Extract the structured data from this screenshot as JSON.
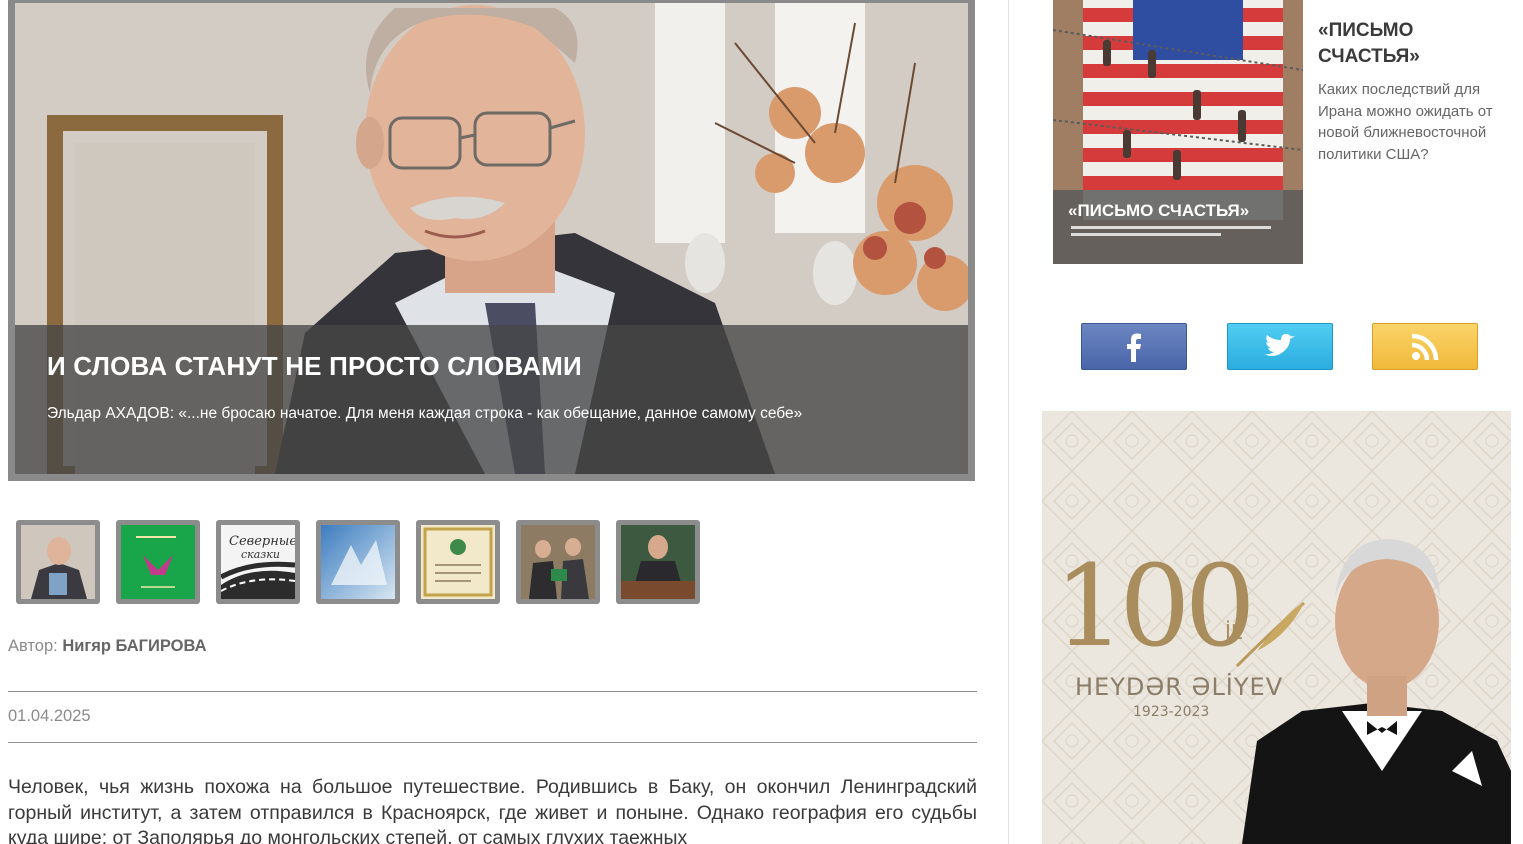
{
  "hero": {
    "title": "И СЛОВА СТАНУТ НЕ ПРОСТО СЛОВАМИ",
    "subtitle": "Эльдар АХАДОВ: «...не бросаю начатое. Для меня каждая строка - как обещание, данное самому себе»"
  },
  "gallery": {
    "thumbnails": [
      {
        "icon": "portrait-with-book-photo"
      },
      {
        "icon": "green-book-cover"
      },
      {
        "icon": "severnye-skazki-book-cover"
      },
      {
        "icon": "blue-book-cover"
      },
      {
        "icon": "diploma-photo"
      },
      {
        "icon": "award-ceremony-photo"
      },
      {
        "icon": "man-at-desk-photo"
      }
    ],
    "thumb_texts": {
      "severnye": "Северные",
      "skazki": "сказки"
    }
  },
  "article": {
    "author_label": "Автор:",
    "author_name": "Нигяр БАГИРОВА",
    "date": "01.04.2025",
    "body": "Человек, чья жизнь похожа на большое путешествие. Родившись в Баку, он окончил Ленинградский горный институт, а затем отправился в Красноярск, где живет и поныне. Однако география его судьбы куда шире: от Заполярья до монгольских степей, от самых глухих таежных"
  },
  "sidebar": {
    "promo": {
      "title": "«ПИСЬМО СЧАСТЬЯ»",
      "description": "Каких последствий для Ирана можно ожидать от новой ближневосточной политики США?",
      "image_caption": "«ПИСЬМО СЧАСТЬЯ»"
    },
    "social": [
      {
        "name": "facebook",
        "icon": "facebook-icon",
        "color": "#5b76b8"
      },
      {
        "name": "twitter",
        "icon": "twitter-icon",
        "color": "#3cbdea"
      },
      {
        "name": "rss",
        "icon": "rss-icon",
        "color": "#f6c54f"
      }
    ],
    "banner": {
      "years": "100",
      "il": "İL",
      "name": "HEYDƏR ƏLİYEV",
      "range": "1923-2023"
    }
  },
  "colors": {
    "frame_gray": "#8a8a8a",
    "caption_overlay": "#464646",
    "banner_gold": "#a98d5c"
  }
}
